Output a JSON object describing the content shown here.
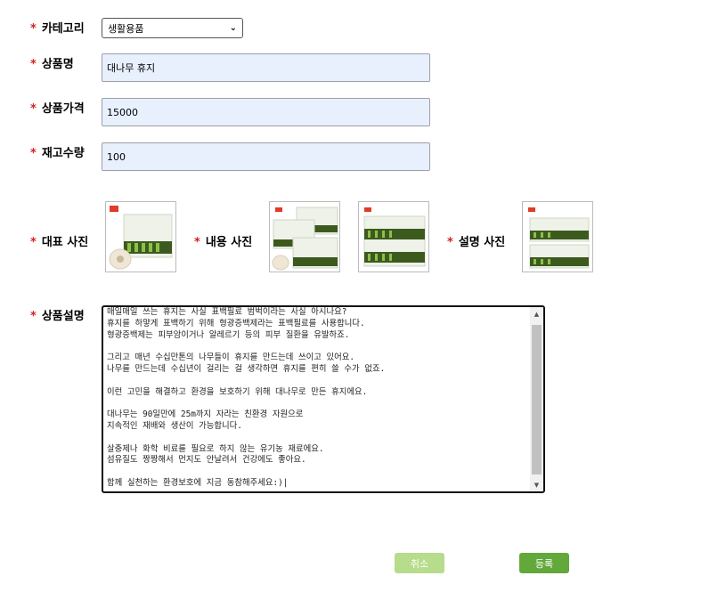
{
  "required_mark": "*",
  "category": {
    "label": "카테고리",
    "selected": "생활용품"
  },
  "name": {
    "label": "상품명",
    "value": "대나무 휴지"
  },
  "price": {
    "label": "상품가격",
    "value": "15000"
  },
  "stock": {
    "label": "재고수량",
    "value": "100"
  },
  "photos": {
    "main_label": "대표 사진",
    "content_label": "내용 사진",
    "desc_label": "설명 사진"
  },
  "description": {
    "label": "상품설명",
    "text": "매일매일 쓰는 휴지는 사실 표백필료 범벅이라는 사실 아시나요?\n휴지를 하얗게 표백하기 위해 형광증백제라는 표백필료를 사용합니다.\n형광증백제는 피부암이거나 알레르기 등의 피부 질환을 유발하죠.\n\n그리고 매년 수십만톤의 나무들이 휴지를 만드는데 쓰이고 있어요.\n나무를 만드는데 수십년이 걸리는 걸 생각하면 휴지를 편히 쓸 수가 없죠.\n\n이런 고민을 해결하고 환경을 보호하기 위해 대나무로 만든 휴지에요.\n\n대나무는 90일만에 25m까지 자라는 친환경 자원으로\n지속적인 재배와 생산이 가능합니다.\n\n살충제나 화학 비료를 필요로 하지 않는 유기농 재료에요.\n섬유질도 짱짱해서 먼지도 안날려서 건강에도 좋아요.\n\n함께 실천하는 환경보호에 지금 동참해주세요:)|"
  },
  "buttons": {
    "cancel": "취소",
    "submit": "등록"
  },
  "colors": {
    "required": "#d62020",
    "input_bg": "#e8f0fe",
    "submit": "#63a83a",
    "cancel": "#b6dc8c"
  }
}
